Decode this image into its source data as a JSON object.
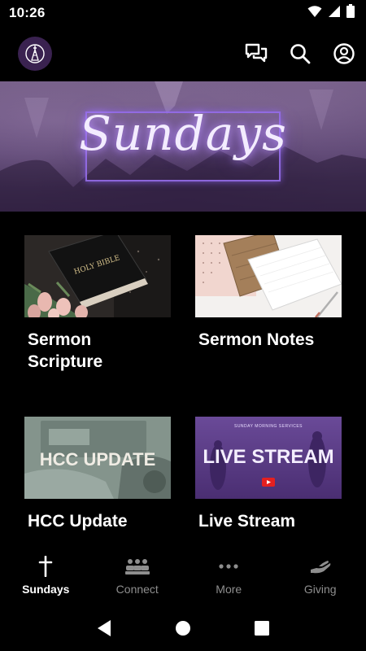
{
  "status_bar": {
    "time": "10:26"
  },
  "banner": {
    "title": "Sundays"
  },
  "cards": [
    {
      "title": "Sermon Scripture",
      "image_text": "HOLY BIBLE"
    },
    {
      "title": "Sermon Notes"
    },
    {
      "title": "HCC Update",
      "image_text": "HCC UPDATE"
    },
    {
      "title": "Live Stream",
      "image_text": "LIVE STREAM",
      "image_subtext": "SUNDAY MORNING SERVICES"
    }
  ],
  "bottom_nav": {
    "items": [
      {
        "label": "Sundays",
        "icon": "cross-icon",
        "active": true
      },
      {
        "label": "Connect",
        "icon": "people-icon",
        "active": false
      },
      {
        "label": "More",
        "icon": "more-dots-icon",
        "active": false
      },
      {
        "label": "Giving",
        "icon": "giving-hand-icon",
        "active": false
      }
    ]
  },
  "colors": {
    "background": "#000000",
    "accent_purple": "#6b4a9c",
    "inactive_nav": "#8e8e8e"
  }
}
